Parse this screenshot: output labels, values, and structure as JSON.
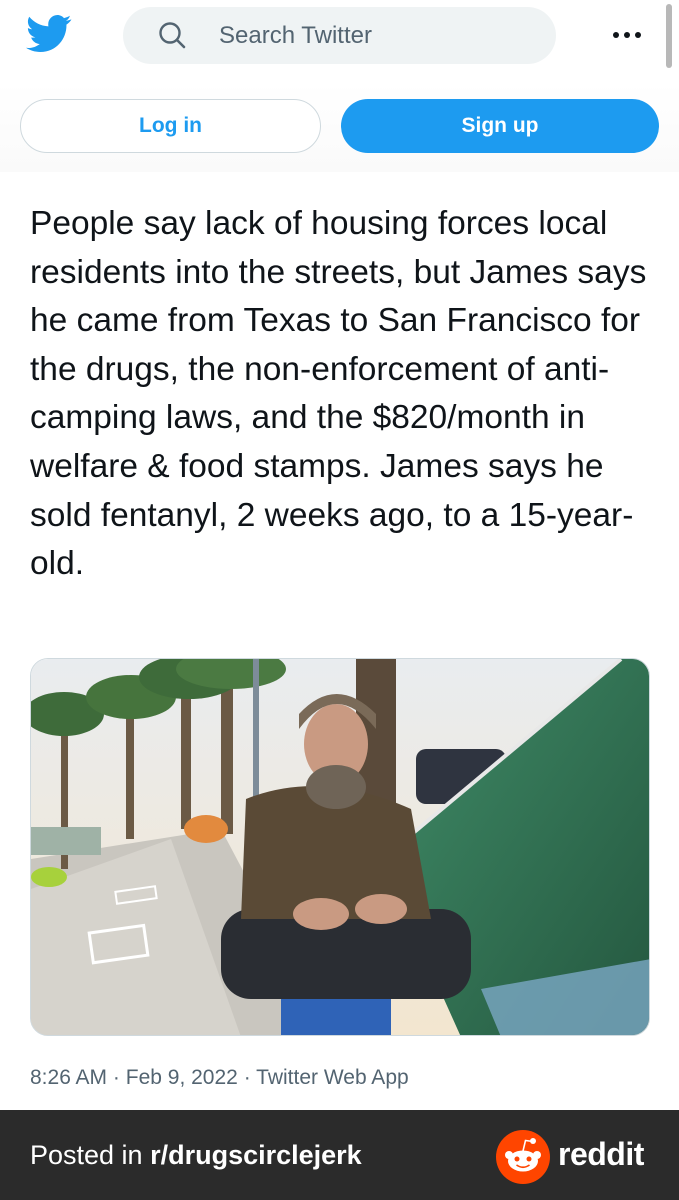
{
  "header": {
    "logo_icon": "twitter-bird-icon",
    "search_placeholder": "Search Twitter",
    "more_icon": "more-dots-icon"
  },
  "auth": {
    "login_label": "Log in",
    "signup_label": "Sign up"
  },
  "tweet": {
    "text": "People say lack of housing forces local residents into the streets, but James says he came from Texas to San Francisco for the drugs, the non-enforcement of anti-camping laws, and the $820/month in welfare & food stamps. James says he sold fentanyl, 2 weeks ago, to a 15-year-old.",
    "time": "8:26 AM",
    "date": "Feb 9, 2022",
    "source": "Twitter Web App",
    "separator": "·"
  },
  "footer": {
    "posted_prefix": "Posted in ",
    "subreddit": "r/drugscirclejerk",
    "brand": "reddit"
  },
  "colors": {
    "twitter_blue": "#1d9bf0",
    "text": "#0f1419",
    "muted": "#536471",
    "footer_bg": "#2b2b2b",
    "reddit_orange": "#ff4500"
  }
}
